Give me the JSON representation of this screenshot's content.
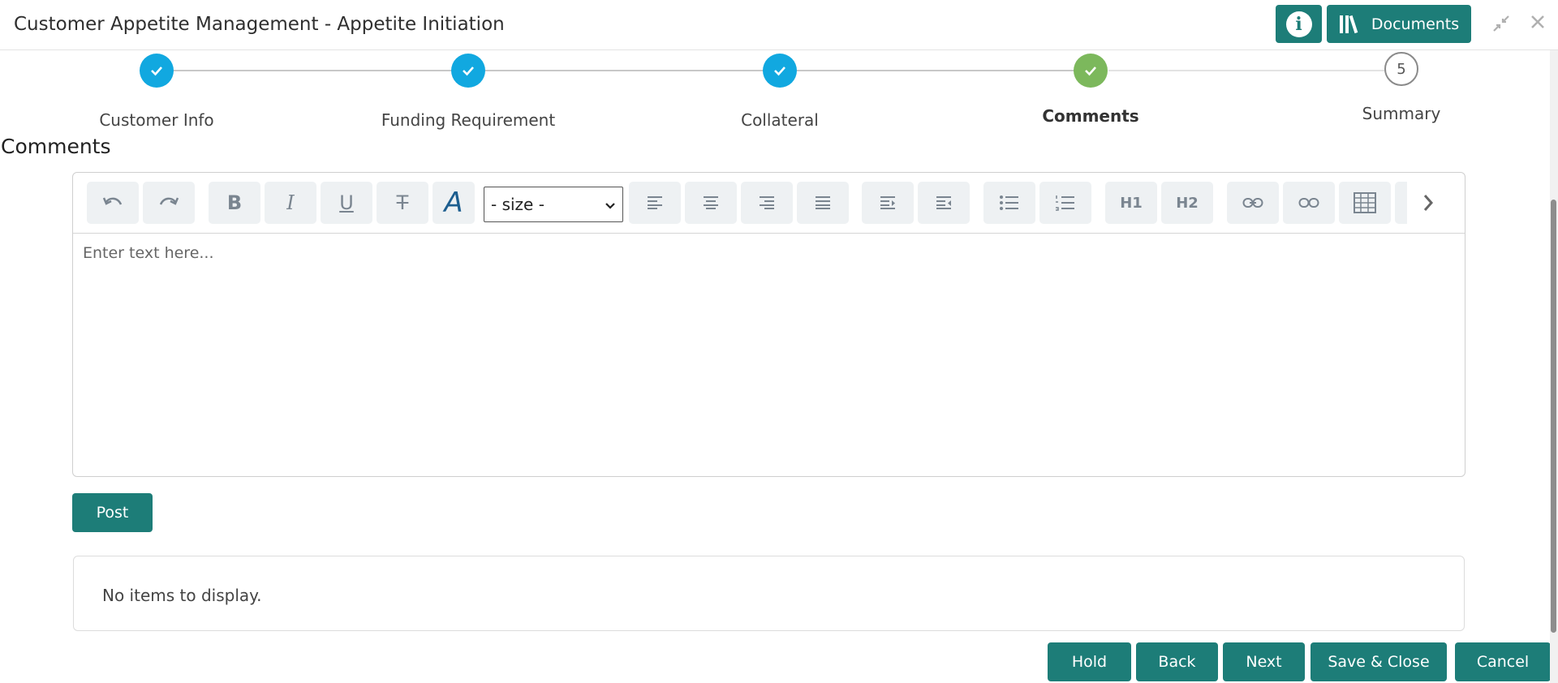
{
  "header": {
    "title": "Customer Appetite Management - Appetite Initiation",
    "documents_label": "Documents",
    "info_glyph": "i"
  },
  "stepper": {
    "steps": [
      {
        "label": "Customer Info",
        "state": "done"
      },
      {
        "label": "Funding Requirement",
        "state": "done"
      },
      {
        "label": "Collateral",
        "state": "done"
      },
      {
        "label": "Comments",
        "state": "active"
      },
      {
        "label": "Summary",
        "state": "todo",
        "number": "5"
      }
    ]
  },
  "section": {
    "title": "Comments"
  },
  "editor": {
    "size_select_value": "- size -",
    "placeholder": "Enter text here...",
    "toolbar_icons": [
      "undo-icon",
      "redo-icon",
      "bold-icon",
      "italic-icon",
      "underline-icon",
      "strikethrough-icon",
      "font-color-icon",
      "align-left-icon",
      "align-center-icon",
      "align-right-icon",
      "align-justify-icon",
      "indent-icon",
      "outdent-icon",
      "bullet-list-icon",
      "numbered-list-icon",
      "heading1-icon",
      "heading2-icon",
      "link-icon",
      "unlink-icon",
      "table-icon",
      "more-icon"
    ]
  },
  "post_label": "Post",
  "comments_list": {
    "empty_text": "No items to display."
  },
  "footer": {
    "hold": "Hold",
    "back": "Back",
    "next": "Next",
    "save_close": "Save & Close",
    "cancel": "Cancel"
  },
  "colors": {
    "accent": "#1d7d78",
    "step_done": "#11a8e0",
    "step_active": "#7cb85c"
  }
}
